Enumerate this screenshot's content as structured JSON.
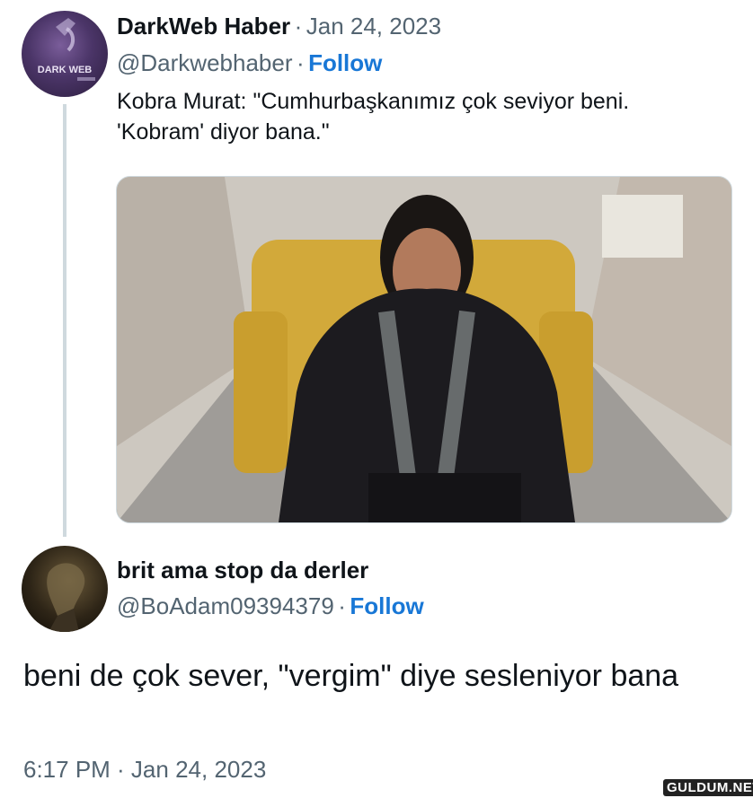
{
  "tweet1": {
    "author_name": "DarkWeb Haber",
    "separator": "·",
    "date": "Jan 24, 2023",
    "handle": "@Darkwebhaber",
    "follow_label": "Follow",
    "text_line1": "Kobra Murat: \"Cumhurbaşkanımız çok seviyor beni.",
    "text_line2": "'Kobram' diyor bana.\"",
    "avatar_text": "DARK WEB"
  },
  "tweet2": {
    "author_name": "brit ama stop da derler",
    "handle": "@BoAdam09394379",
    "separator": "·",
    "follow_label": "Follow",
    "text": "beni de çok sever, \"vergim\" diye sesleniyor bana",
    "timestamp": "6:17 PM · Jan 24, 2023"
  },
  "watermark": "GULDUM.NET",
  "colors": {
    "follow": "#1877d6",
    "muted": "#536471",
    "thread_line": "#cfd9de"
  }
}
